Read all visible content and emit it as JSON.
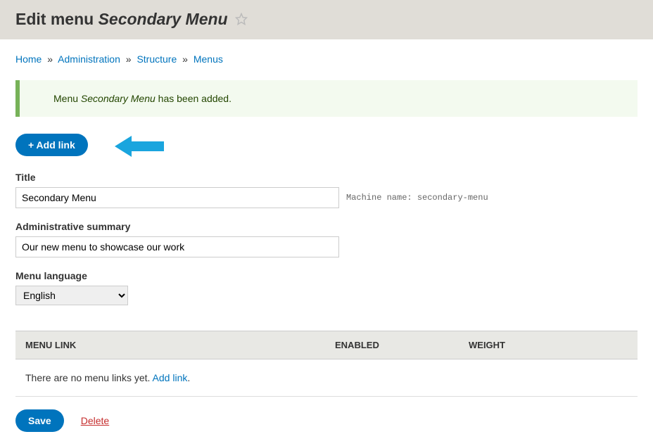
{
  "header": {
    "title_prefix": "Edit menu ",
    "title_name": "Secondary Menu"
  },
  "breadcrumb": {
    "home": "Home",
    "admin": "Administration",
    "structure": "Structure",
    "menus": "Menus"
  },
  "message": {
    "prefix": "Menu ",
    "name": "Secondary Menu",
    "suffix": " has been added."
  },
  "add_link_button": "+ Add link",
  "form": {
    "title_label": "Title",
    "title_value": "Secondary Menu",
    "machine_name_label": "Machine name: ",
    "machine_name_value": "secondary-menu",
    "summary_label": "Administrative summary",
    "summary_value": "Our new menu to showcase our work",
    "language_label": "Menu language",
    "language_value": "English"
  },
  "table": {
    "col_menulink": "MENU LINK",
    "col_enabled": "ENABLED",
    "col_weight": "WEIGHT",
    "empty_text": "There are no menu links yet. ",
    "empty_link": "Add link",
    "empty_suffix": "."
  },
  "actions": {
    "save": "Save",
    "delete": "Delete"
  }
}
